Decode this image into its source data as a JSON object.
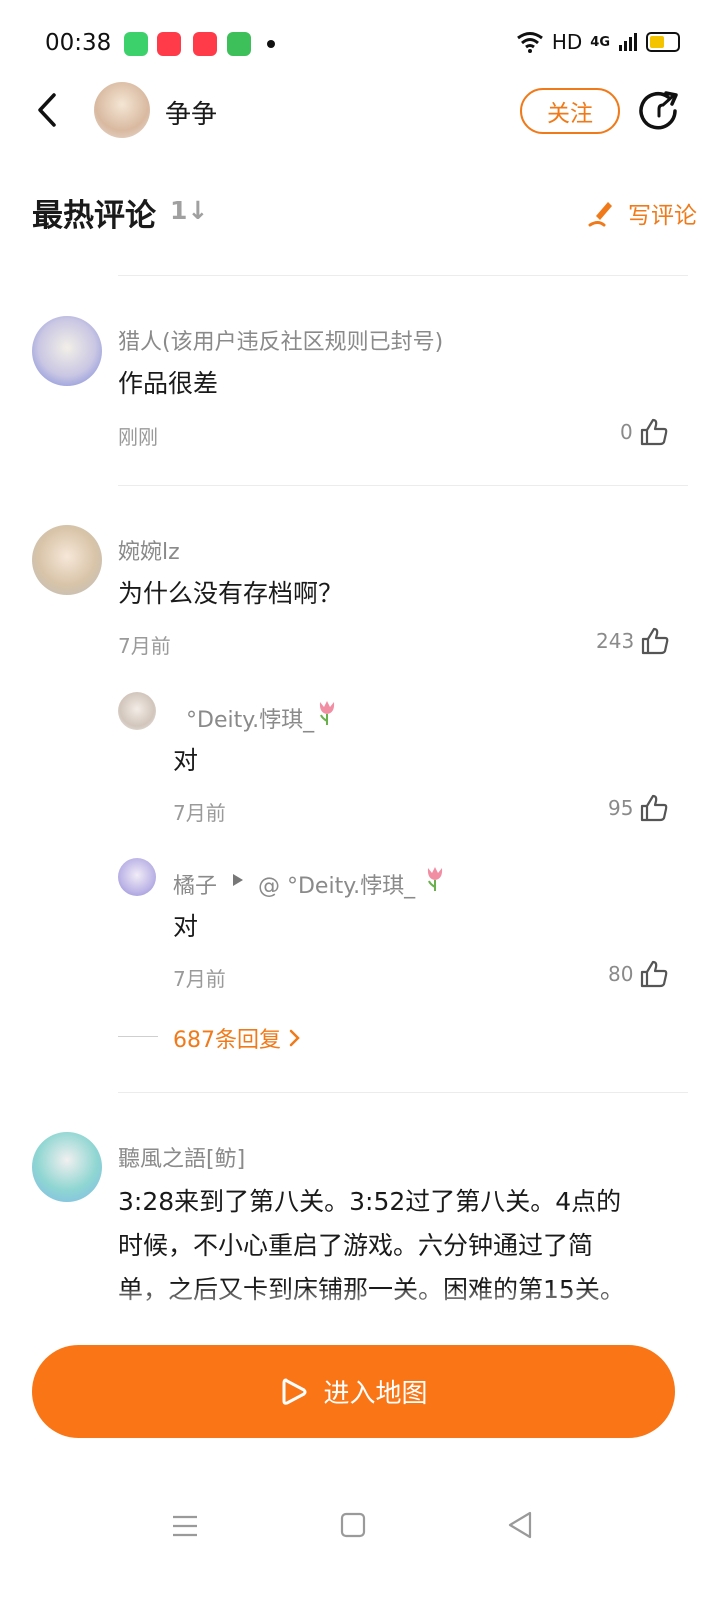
{
  "status_bar": {
    "time": "00:38",
    "network_label": "HD",
    "signal_label": "4G"
  },
  "header": {
    "author_name": "争争",
    "follow_label": "关注"
  },
  "section": {
    "title": "最热评论",
    "sort_symbol": "1↓",
    "write_label": "写评论"
  },
  "comments": [
    {
      "user": "猎人(该用户违反社区规则已封号)",
      "text": "作品很差",
      "time": "刚刚",
      "likes": "0"
    },
    {
      "user": "婉婉lz",
      "text": "为什么没有存档啊？",
      "time": "7月前",
      "likes": "243",
      "replies": [
        {
          "user": "°Deity.悖琪_",
          "text": "对",
          "time": "7月前",
          "likes": "95"
        },
        {
          "user": "橘子",
          "reply_to": "@ °Deity.悖琪_",
          "text": "对",
          "time": "7月前",
          "likes": "80"
        }
      ],
      "reply_count_label": "687条回复"
    },
    {
      "user": "聽風之語[鲂]",
      "text_lines": [
        "3:28来到了第八关。3:52过了第八关。4点的",
        "时候，不小心重启了游戏。六分钟通过了简",
        "单，之后又卡到床铺那一关。困难的第15关。"
      ]
    }
  ],
  "bottom": {
    "enter_label": "进入地图"
  },
  "colors": {
    "accent": "#f07a1a",
    "button": "#f97516"
  }
}
